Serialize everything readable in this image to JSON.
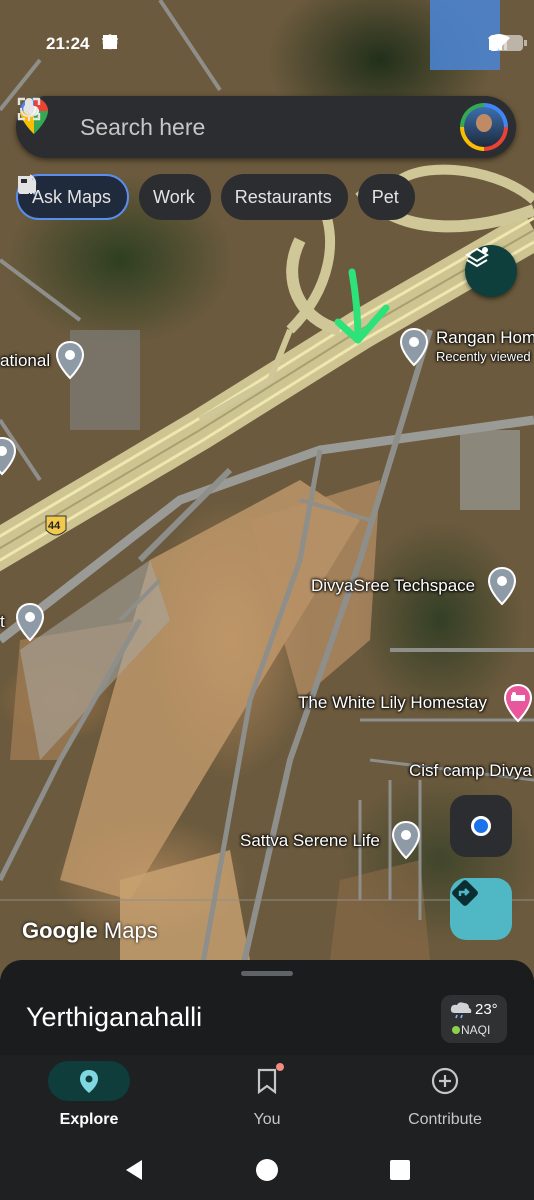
{
  "status_bar": {
    "time": "21:24"
  },
  "search": {
    "placeholder": "Search here"
  },
  "chips": [
    {
      "label": "Ask Maps"
    },
    {
      "label": "Work"
    },
    {
      "label": "Restaurants"
    },
    {
      "label": "Pet"
    }
  ],
  "map": {
    "places": [
      {
        "label": "Rangan Hom"
      },
      {
        "label": "Recently viewed"
      },
      {
        "label": "ational"
      },
      {
        "label": "DivyaSree Techspace"
      },
      {
        "label": "t"
      },
      {
        "label": "The White Lily Homestay"
      },
      {
        "label": "Cisf camp Divya"
      },
      {
        "label": "Sattva Serene Life"
      }
    ],
    "highway_shield": "44",
    "logo": {
      "google": "Google",
      "maps": "Maps"
    }
  },
  "sheet": {
    "area_name": "Yerthiganahalli",
    "weather": {
      "temp": "23°",
      "aqi": "NAQI"
    }
  },
  "nav": {
    "items": [
      {
        "label": "Explore"
      },
      {
        "label": "You"
      },
      {
        "label": "Contribute"
      }
    ]
  },
  "colors": {
    "accent_blue": "#1a73e8",
    "chip_bg": "#2b2d31",
    "nav_active": "#0e3d3b",
    "directions": "#4fb8c4",
    "annotation_arrow": "#2ee27a"
  }
}
